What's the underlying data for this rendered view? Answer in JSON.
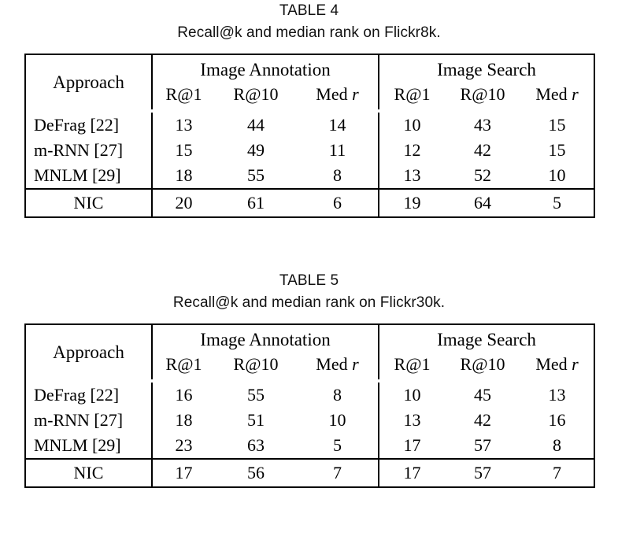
{
  "tables": [
    {
      "id": "table-4",
      "caption_title": "TABLE 4",
      "caption_subtitle": "Recall@k and median rank on Flickr8k.",
      "header": {
        "approach": "Approach",
        "group_annotation": "Image Annotation",
        "group_search": "Image Search",
        "sub": [
          "R@1",
          "R@10",
          "Med ",
          "R@1",
          "R@10",
          "Med "
        ],
        "med_italic": "r"
      },
      "rows": [
        {
          "approach": "DeFrag [22]",
          "centered": false,
          "values": [
            "13",
            "44",
            "14",
            "10",
            "43",
            "15"
          ],
          "bold": [
            false,
            false,
            false,
            false,
            false,
            false
          ]
        },
        {
          "approach": "m-RNN [27]",
          "centered": false,
          "values": [
            "15",
            "49",
            "11",
            "12",
            "42",
            "15"
          ],
          "bold": [
            false,
            false,
            false,
            false,
            false,
            false
          ]
        },
        {
          "approach": "MNLM [29]",
          "centered": false,
          "values": [
            "18",
            "55",
            "8",
            "13",
            "52",
            "10"
          ],
          "bold": [
            false,
            false,
            false,
            false,
            false,
            false
          ]
        }
      ],
      "summary_row": {
        "approach": "NIC",
        "centered": true,
        "values": [
          "20",
          "61",
          "6",
          "19",
          "64",
          "5"
        ],
        "bold": [
          true,
          true,
          true,
          true,
          true,
          true
        ]
      }
    },
    {
      "id": "table-5",
      "caption_title": "TABLE 5",
      "caption_subtitle": "Recall@k and median rank on Flickr30k.",
      "header": {
        "approach": "Approach",
        "group_annotation": "Image Annotation",
        "group_search": "Image Search",
        "sub": [
          "R@1",
          "R@10",
          "Med ",
          "R@1",
          "R@10",
          "Med "
        ],
        "med_italic": "r"
      },
      "rows": [
        {
          "approach": "DeFrag [22]",
          "centered": false,
          "values": [
            "16",
            "55",
            "8",
            "10",
            "45",
            "13"
          ],
          "bold": [
            false,
            false,
            false,
            false,
            false,
            false
          ]
        },
        {
          "approach": "m-RNN [27]",
          "centered": false,
          "values": [
            "18",
            "51",
            "10",
            "13",
            "42",
            "16"
          ],
          "bold": [
            false,
            false,
            false,
            false,
            false,
            false
          ]
        },
        {
          "approach": "MNLM [29]",
          "centered": false,
          "values": [
            "23",
            "63",
            "5",
            "17",
            "57",
            "8"
          ],
          "bold": [
            true,
            true,
            true,
            true,
            true,
            true
          ]
        }
      ],
      "summary_row": {
        "approach": "NIC",
        "centered": true,
        "values": [
          "17",
          "56",
          "7",
          "17",
          "57",
          "7"
        ],
        "bold": [
          false,
          false,
          false,
          true,
          true,
          true
        ]
      }
    }
  ],
  "colors": {
    "text": "#000000",
    "rule": "#000000",
    "background": "#ffffff"
  }
}
